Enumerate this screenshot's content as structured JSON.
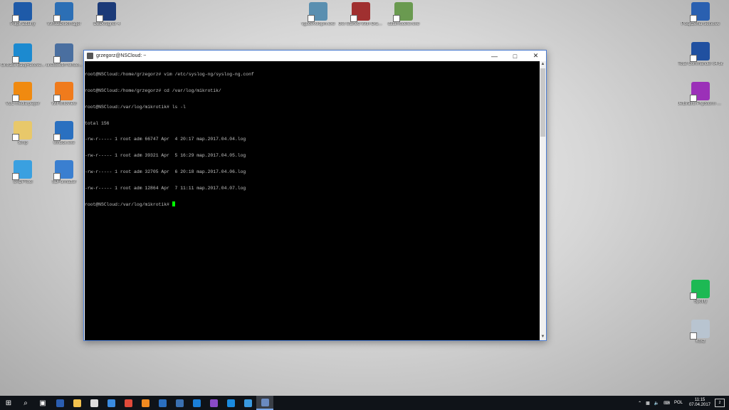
{
  "desktop_icons": [
    {
      "id": "pulpit",
      "label": "Pulpit Zdalny",
      "icon": "remote-desktop-icon",
      "color": "#1e5aa8"
    },
    {
      "id": "win32",
      "label": "Win32DiskImager",
      "icon": "disk-imager-icon",
      "color": "#2c6fb5"
    },
    {
      "id": "dbdesigner",
      "label": "DBDesigner 4",
      "icon": "db-designer-icon",
      "color": "#1b3a78"
    },
    {
      "id": "vsbg",
      "label": "vgbdevelopm.exe",
      "icon": "app-exe-icon",
      "color": "#5a8fb0"
    },
    {
      "id": "getstarted",
      "label": "Get Started With Oracle Database 11g",
      "icon": "oracle-db-icon",
      "color": "#a03030"
    },
    {
      "id": "datamodeler",
      "label": "datamodeler.exe",
      "icon": "data-modeler-icon",
      "color": "#6a9a50"
    },
    {
      "id": "polaczenia",
      "label": "Połączenia sieciowe",
      "icon": "network-connections-icon",
      "color": "#2a60b0"
    },
    {
      "id": "ontrack",
      "label": "Ontrack EasyRecove...",
      "icon": "ontrack-icon",
      "color": "#1c8ad0"
    },
    {
      "id": "unetbootin",
      "label": "unetbootin-windo...",
      "icon": "unetbootin-icon",
      "color": "#4a6fa0"
    },
    {
      "id": "totalcmd",
      "label": "Total Commander 64 bit",
      "icon": "total-commander-icon",
      "color": "#2050a0"
    },
    {
      "id": "vlc",
      "label": "VLC media player",
      "icon": "vlc-icon",
      "color": "#f08a10"
    },
    {
      "id": "wifi",
      "label": "WiFiInfoView",
      "icon": "wifi-icon",
      "color": "#f07b1c"
    },
    {
      "id": "phpstorm",
      "label": "JetBrains PhpStorm 2016.3.2",
      "icon": "phpstorm-icon",
      "color": "#9b30b8"
    },
    {
      "id": "temp",
      "label": "temp",
      "icon": "folder-icon",
      "color": "#e8c86a"
    },
    {
      "id": "winbox",
      "label": "winbox.exe",
      "icon": "winbox-icon",
      "color": "#2a70c0"
    },
    {
      "id": "sadp",
      "label": "SADPTool",
      "icon": "sadp-icon",
      "color": "#3aa0e0"
    },
    {
      "id": "sdformatter",
      "label": "SDFormatter",
      "icon": "sdformatter-icon",
      "color": "#3a7fd0"
    },
    {
      "id": "spotify",
      "label": "Spotify",
      "icon": "spotify-icon",
      "color": "#1db954"
    },
    {
      "id": "kosz",
      "label": "Kosz",
      "icon": "recycle-bin-icon",
      "color": "#b8c4d0"
    }
  ],
  "terminal": {
    "title": "grzegorz@NSCloud: ~",
    "lines": [
      "root@NSCloud:/home/grzegorz# vim /etc/syslog-ng/syslog-ng.conf",
      "root@NSCloud:/home/grzegorz# cd /var/log/mikrotik/",
      "root@NSCloud:/var/log/mikrotik# ls -l",
      "total 156",
      "-rw-r----- 1 root adm 66747 Apr  4 20:17 map.2017.04.04.log",
      "-rw-r----- 1 root adm 39321 Apr  5 16:29 map.2017.04.05.log",
      "-rw-r----- 1 root adm 32705 Apr  6 20:18 map.2017.04.06.log",
      "-rw-r----- 1 root adm 12864 Apr  7 11:11 map.2017.04.07.log"
    ],
    "prompt": "root@NSCloud:/var/log/mikrotik# ",
    "cursor_color": "#00ff00"
  },
  "taskbar": {
    "items": [
      {
        "icon": "start-windows-icon",
        "color": "#ffffff"
      },
      {
        "icon": "search-icon",
        "color": "#ffffff"
      },
      {
        "icon": "task-view-icon",
        "color": "#ffffff"
      },
      {
        "icon": "save-app-icon",
        "color": "#2a5db0"
      },
      {
        "icon": "file-explorer-icon",
        "color": "#f2c14e"
      },
      {
        "icon": "tablet-app-icon",
        "color": "#dddddd"
      },
      {
        "icon": "internet-explorer-icon",
        "color": "#3a8be0"
      },
      {
        "icon": "chrome-icon",
        "color": "#e04a3a"
      },
      {
        "icon": "firefox-icon",
        "color": "#f08a20"
      },
      {
        "icon": "vpn-app-icon",
        "color": "#2a6fc0"
      },
      {
        "icon": "network-app-icon",
        "color": "#3a70b0"
      },
      {
        "icon": "teamviewer-icon",
        "color": "#1a7fd8"
      },
      {
        "icon": "visual-studio-icon",
        "color": "#8a4ac8"
      },
      {
        "icon": "edge-icon",
        "color": "#1a8be0"
      },
      {
        "icon": "remote-desktop-taskbar-icon",
        "color": "#3a9ae0"
      },
      {
        "icon": "putty-icon",
        "color": "#6a8ac0"
      }
    ],
    "language": "POL",
    "time": "11:15",
    "date": "07.04.2017",
    "notifications": "2"
  }
}
